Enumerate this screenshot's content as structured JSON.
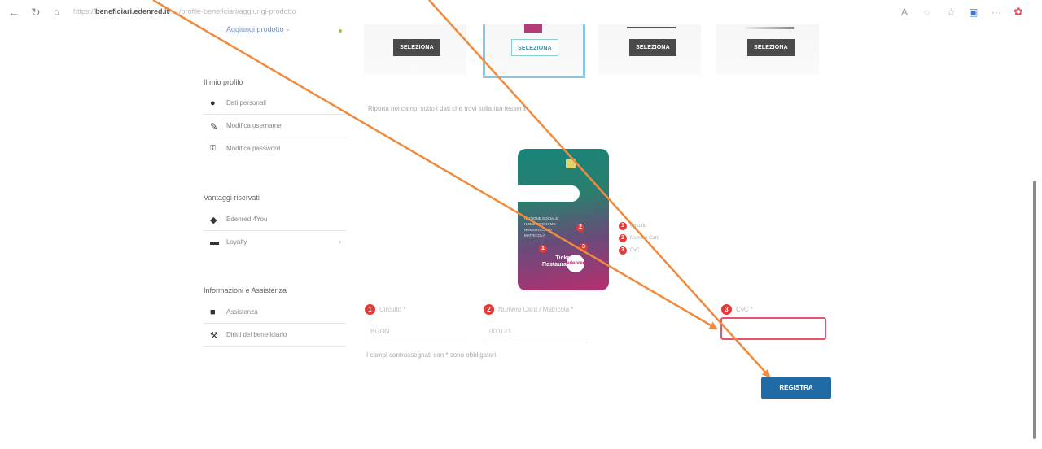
{
  "browser": {
    "url_prefix": "https://",
    "url_domain": "beneficiari.edenred.it",
    "url_path": "/... /profile-beneficiari/aggiungi-prodotto",
    "back_icon": "back-arrow-icon",
    "reload_icon": "reload-icon"
  },
  "top": {
    "link_label": "Aggiungi prodotto"
  },
  "card_selector": {
    "buttons": [
      "SELEZIONA",
      "SELEZIONA",
      "SELEZIONA",
      "SELEZIONA"
    ],
    "selected_index": 1
  },
  "sidebar": {
    "profile_title": "Il mio profilo",
    "profile_items": [
      {
        "icon": "user-circle-icon",
        "label": "Dati personali"
      },
      {
        "icon": "pencil-icon",
        "label": "Modifica username"
      },
      {
        "icon": "key-icon",
        "label": "Modifica password"
      }
    ],
    "benefits_title": "Vantaggi riservati",
    "benefits_items": [
      {
        "icon": "tag-icon",
        "label": "Edenred 4You"
      },
      {
        "icon": "loyalty-card-icon",
        "label": "Loyalty"
      }
    ],
    "info_title": "Informazioni e Assistenza",
    "info_items": [
      {
        "icon": "chat-icon",
        "label": "Assistenza"
      },
      {
        "icon": "gavel-icon",
        "label": "Diritti del beneficiario"
      }
    ]
  },
  "main": {
    "instructions": "Riporta nei campi sotto i dati che trovi sulla tua tessera",
    "card": {
      "lines": [
        "Ragione sociale",
        "Nome Cognome",
        "Numero card",
        "Matricola"
      ],
      "logo_line1": "Ticket",
      "logo_line2": "Restaurant",
      "brand": "edenred"
    },
    "legend": [
      {
        "num": "1",
        "label": "Circuito"
      },
      {
        "num": "2",
        "label": "Numero Card"
      },
      {
        "num": "3",
        "label": "CvC"
      }
    ],
    "fields": [
      {
        "num": "1",
        "label": "Circuito *",
        "value": "BGON"
      },
      {
        "num": "2",
        "label": "Numero Card / Matricola *",
        "value": "000123"
      },
      {
        "num": "3",
        "label": "CvC *",
        "value": ""
      }
    ],
    "required_note": "I campi contrassegnati con * sono obbligatori",
    "submit_label": "REGISTRA"
  },
  "colors": {
    "accent_blue": "#1f6aa5",
    "error_red": "#e8536a",
    "badge_red": "#e53935",
    "annotation_orange": "#f08a3c"
  }
}
